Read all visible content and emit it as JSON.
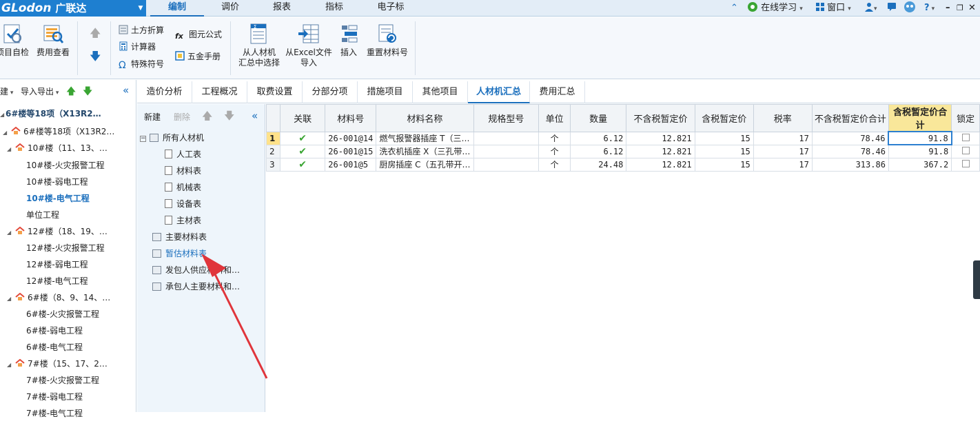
{
  "logo": {
    "brand": "GLodon",
    "product": "广联达"
  },
  "menu": {
    "tabs": [
      "编制",
      "调价",
      "报表",
      "指标",
      "电子标"
    ],
    "active": "编制"
  },
  "topright": {
    "online_learning": "在线学习",
    "window": "窗口",
    "help": "?"
  },
  "ribbon": {
    "self_check": "项目自检",
    "fee_view": "费用查看",
    "earthwork": "土方折算",
    "calculator": "计算器",
    "special_symbol": "特殊符号",
    "element_formula": "图元公式",
    "hardware_manual": "五金手册",
    "select_from_summary_l1": "从人材机",
    "select_from_summary_l2": "汇总中选择",
    "from_excel_l1": "从Excel文件",
    "from_excel_l2": "导入",
    "insert": "插入",
    "reset_material_no": "重置材料号"
  },
  "left_panel": {
    "new_label": "建",
    "import_export": "导入导出",
    "items": [
      {
        "text": "6#楼等18项（X13R2…",
        "kind": "root"
      },
      {
        "text": "6#楼等18项（X13R2…",
        "kind": "project"
      },
      {
        "text": "10#楼（11、13、…",
        "kind": "building"
      },
      {
        "text": "10#楼-火灾报警工程",
        "kind": "leaf"
      },
      {
        "text": "10#楼-弱电工程",
        "kind": "leaf"
      },
      {
        "text": "10#楼-电气工程",
        "kind": "selected"
      },
      {
        "text": "单位工程",
        "kind": "leaf"
      },
      {
        "text": "12#楼（18、19、…",
        "kind": "building"
      },
      {
        "text": "12#楼-火灾报警工程",
        "kind": "leaf"
      },
      {
        "text": "12#楼-弱电工程",
        "kind": "leaf"
      },
      {
        "text": "12#楼-电气工程",
        "kind": "leaf"
      },
      {
        "text": "6#楼（8、9、14、…",
        "kind": "building"
      },
      {
        "text": "6#楼-火灾报警工程",
        "kind": "leaf"
      },
      {
        "text": "6#楼-弱电工程",
        "kind": "leaf"
      },
      {
        "text": "6#楼-电气工程",
        "kind": "leaf"
      },
      {
        "text": "7#楼（15、17、2…",
        "kind": "building"
      },
      {
        "text": "7#楼-火灾报警工程",
        "kind": "leaf"
      },
      {
        "text": "7#楼-弱电工程",
        "kind": "leaf"
      },
      {
        "text": "7#楼-电气工程",
        "kind": "leaf"
      }
    ]
  },
  "tabs": [
    "造价分析",
    "工程概况",
    "取费设置",
    "分部分项",
    "措施项目",
    "其他项目",
    "人材机汇总",
    "费用汇总"
  ],
  "active_tab": "人材机汇总",
  "mid_panel": {
    "new": "新建",
    "delete": "删除",
    "root": "所有人材机",
    "children": [
      "人工表",
      "材料表",
      "机械表",
      "设备表",
      "主材表"
    ],
    "others": [
      "主要材料表",
      "暂估材料表",
      "发包人供应材料和…",
      "承包人主要材料和…"
    ],
    "highlighted": "暂估材料表"
  },
  "grid": {
    "columns": [
      "关联",
      "材料号",
      "材料名称",
      "规格型号",
      "单位",
      "数量",
      "不含税暂定价",
      "含税暂定价",
      "税率",
      "不含税暂定价合计",
      "含税暂定价合计",
      "锁定"
    ],
    "highlighted_column": "含税暂定价合计",
    "rows": [
      {
        "no": "1",
        "code": "26-001@14",
        "name": "燃气报警器插座 T（三…",
        "spec": "",
        "unit": "个",
        "qty": "6.12",
        "price_ex": "12.821",
        "price_in": "15",
        "tax": "17",
        "total_ex": "78.46",
        "total_in": "91.8"
      },
      {
        "no": "2",
        "code": "26-001@15",
        "name": "洗衣机插座 X（三孔带…",
        "spec": "",
        "unit": "个",
        "qty": "6.12",
        "price_ex": "12.821",
        "price_in": "15",
        "tax": "17",
        "total_ex": "78.46",
        "total_in": "91.8"
      },
      {
        "no": "3",
        "code": "26-001@5",
        "name": "厨房插座 C（五孔带开…",
        "spec": "",
        "unit": "个",
        "qty": "24.48",
        "price_ex": "12.821",
        "price_in": "15",
        "tax": "17",
        "total_ex": "313.86",
        "total_in": "367.2"
      }
    ]
  },
  "colors": {
    "accent": "#1b6fbd",
    "logo_bg": "#1e7fd0",
    "highlight_header": "#f9e79a",
    "annotation_arrow": "#e0353b",
    "check_green": "#3aa533"
  }
}
